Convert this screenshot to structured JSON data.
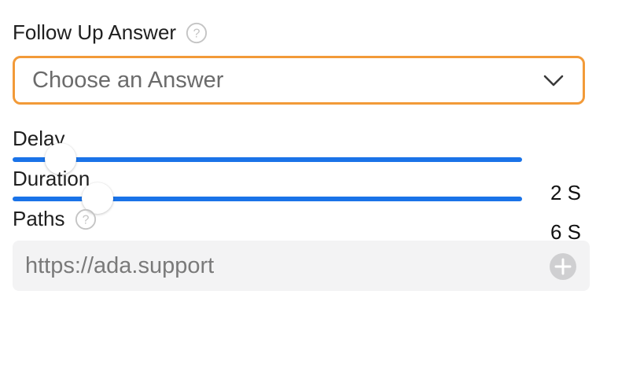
{
  "follow_up": {
    "label": "Follow Up Answer",
    "help_icon": "question-circle-icon",
    "select": {
      "selected_value": "Choose an Answer",
      "chevron_icon": "chevron-down-icon",
      "border_color": "#f29a38"
    }
  },
  "delay": {
    "label": "Delay",
    "value_text": "2 S",
    "position_fraction": 0.094
  },
  "duration": {
    "label": "Duration",
    "value_text": "6 S",
    "position_fraction": 0.166
  },
  "paths": {
    "label": "Paths",
    "help_icon": "question-circle-icon",
    "input": {
      "value": "",
      "placeholder": "https://ada.support"
    },
    "add_icon": "plus-circle-icon"
  },
  "colors": {
    "accent": "#1a73e8",
    "focus_border": "#f29a38",
    "input_bg": "#f3f3f4",
    "icon_gray": "#c4c4c4"
  }
}
